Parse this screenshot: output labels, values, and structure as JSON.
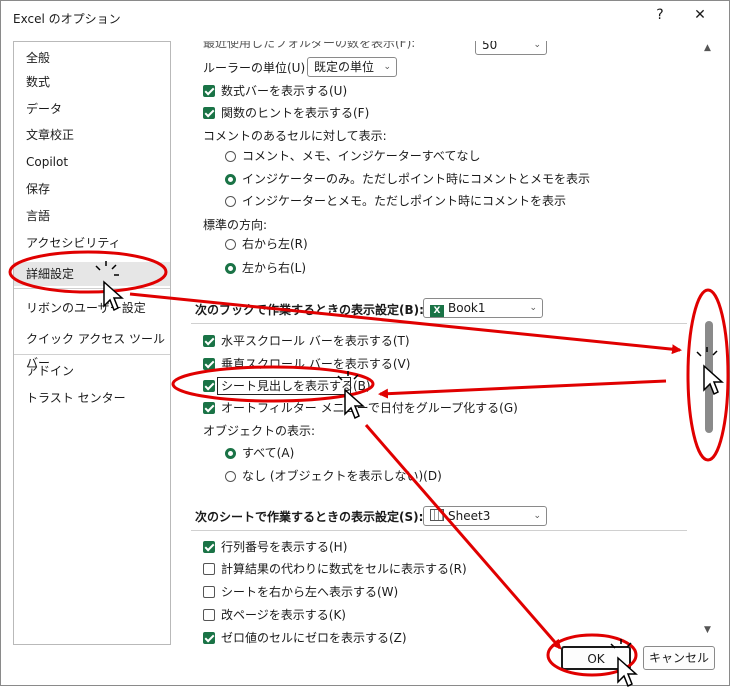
{
  "window": {
    "title": "Excel のオプション",
    "help": "?",
    "close": "✕"
  },
  "sidebar": {
    "items": [
      "全般",
      "数式",
      "データ",
      "文章校正",
      "Copilot",
      "保存",
      "言語",
      "アクセシビリティ",
      "詳細設定",
      "リボンのユーザー設定",
      "クイック アクセス ツール バー",
      "アドイン",
      "トラスト センター"
    ],
    "active_index": 8
  },
  "content": {
    "cut_top": "最近使用したフォルダーの数を表示(F):",
    "cut_top_value": "50",
    "ruler_label": "ルーラーの単位(U)",
    "ruler_value": "既定の単位",
    "show_formula_bar": "数式バーを表示する(U)",
    "show_function_tips": "関数のヒントを表示する(F)",
    "comment_heading": "コメントのあるセルに対して表示:",
    "comment_opt1": "コメント、メモ、インジケーターすべてなし",
    "comment_opt2": "インジケーターのみ。ただしポイント時にコメントとメモを表示",
    "comment_opt3": "インジケーターとメモ。ただしポイント時にコメントを表示",
    "direction_heading": "標準の方向:",
    "dir_rtl": "右から左(R)",
    "dir_ltr": "左から右(L)",
    "workbook_section": "次のブックで作業するときの表示設定(B):",
    "workbook_value": "Book1",
    "hscroll": "水平スクロール バーを表示する(T)",
    "vscroll": "垂直スクロール バーを表示する(V)",
    "sheet_tabs": "シート見出しを表示する(B)",
    "autofilter": "オートフィルター メニューで日付をグループ化する(G)",
    "objects_heading": "オブジェクトの表示:",
    "obj_all": "すべて(A)",
    "obj_none": "なし (オブジェクトを表示しない)(D)",
    "sheet_section": "次のシートで作業するときの表示設定(S):",
    "sheet_value": "Sheet3",
    "row_col_headers": "行列番号を表示する(H)",
    "show_formulas": "計算結果の代わりに数式をセルに表示する(R)",
    "rtl_sheet": "シートを右から左へ表示する(W)",
    "page_breaks": "改ページを表示する(K)",
    "zero_values": "ゼロ値のセルにゼロを表示する(Z)"
  },
  "buttons": {
    "ok": "OK",
    "cancel": "キャンセル"
  },
  "icons": {
    "scroll_up": "▲",
    "scroll_down": "▼",
    "dropdown": "⌄",
    "xl_badge": "X"
  },
  "colors": {
    "accent": "#1a7346",
    "annotation": "#e00000"
  }
}
